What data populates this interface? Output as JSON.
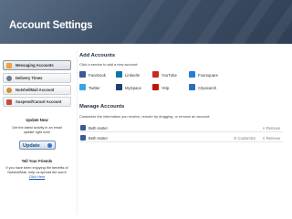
{
  "header": {
    "title": "Account Settings"
  },
  "sidebar": {
    "items": [
      {
        "label": "Messaging Accounts",
        "icon": "messaging-icon",
        "color": "#f2a23a"
      },
      {
        "label": "Delivery Times",
        "icon": "clock-icon",
        "color": "#6b7c8f"
      },
      {
        "label": "NutshellMail Account",
        "icon": "nutshell-icon",
        "color": "#d48f2e"
      },
      {
        "label": "Suspend/Cancel Account",
        "icon": "suspend-icon",
        "color": "#c94a3a"
      }
    ],
    "update": {
      "heading": "Update Now",
      "text": "Get the latest activity in an email update right now!",
      "button": "Update"
    },
    "friends": {
      "heading": "Tell Your Friends",
      "text": "If you have been enjoying the benefits of NutshellMail, help us spread the word!",
      "link": "Click Here"
    }
  },
  "main": {
    "add": {
      "title": "Add Accounts",
      "subtitle": "Click a service to add a new account:",
      "services": [
        {
          "label": "Facebook",
          "icon": "facebook-icon",
          "color": "#3b5998"
        },
        {
          "label": "LinkedIn",
          "icon": "linkedin-icon",
          "color": "#0e76a8"
        },
        {
          "label": "YouTube",
          "icon": "youtube-icon",
          "color": "#cc2a1f"
        },
        {
          "label": "Foursquare",
          "icon": "foursquare-icon",
          "color": "#2d7bd6"
        },
        {
          "label": "Twitter",
          "icon": "twitter-icon",
          "color": "#3aa4e0"
        },
        {
          "label": "MySpace",
          "icon": "myspace-icon",
          "color": "#1d3f6e"
        },
        {
          "label": "Yelp",
          "icon": "yelp-icon",
          "color": "#c41200"
        },
        {
          "label": "Citysearch",
          "icon": "citysearch-icon",
          "color": "#2a6fb8"
        }
      ]
    },
    "manage": {
      "title": "Manage Accounts",
      "subtitle": "Customize the information you receive, reorder by dragging, or remove an account:",
      "accounts": [
        {
          "name": "Beth Harter",
          "remove": "Remove"
        },
        {
          "name": "Beth Harter",
          "customize": "Customize",
          "remove": "Remove"
        }
      ]
    }
  }
}
